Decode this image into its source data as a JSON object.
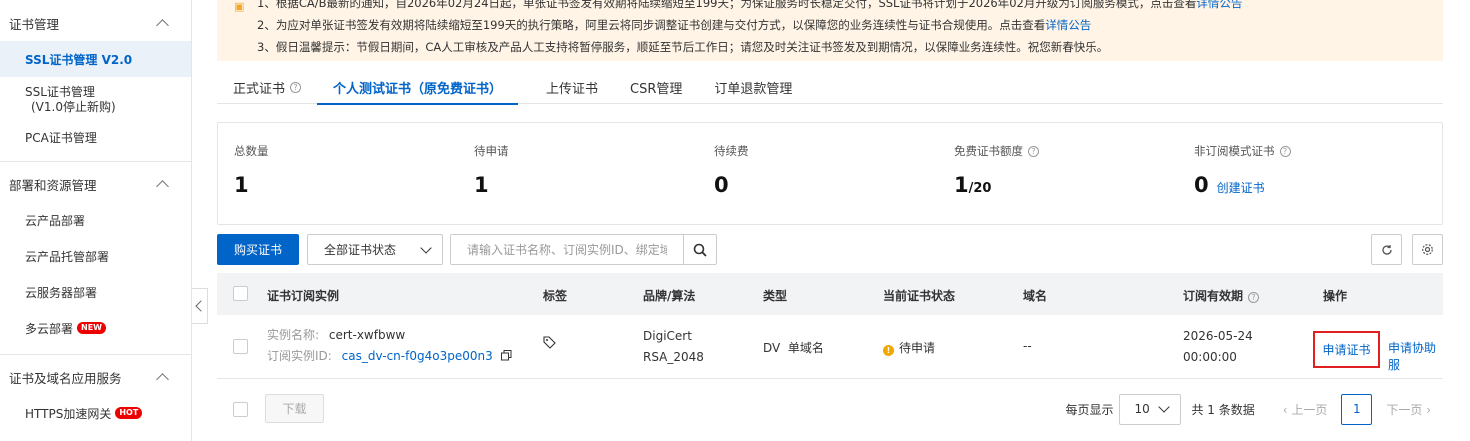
{
  "sidebar": {
    "groups": [
      {
        "label": "证书管理"
      },
      {
        "label": "部署和资源管理"
      },
      {
        "label": "证书及域名应用服务"
      }
    ],
    "items": [
      {
        "label": "SSL证书管理 V2.0"
      },
      {
        "label": "SSL证书管理"
      },
      {
        "label": "(V1.0停止新购)"
      },
      {
        "label": "PCA证书管理"
      },
      {
        "label": "云产品部署"
      },
      {
        "label": "云产品托管部署"
      },
      {
        "label": "云服务器部署"
      },
      {
        "label": "多云部署",
        "badge": "NEW"
      },
      {
        "label": "HTTPS加速网关",
        "badge": "HOT"
      }
    ]
  },
  "notice": {
    "line1": "1、根据CA/B最新的通知，自2026年02月24日起，单张证书签发有效期将陆续缩短至199天；为保证服务时长稳定交付，SSL证书将计划于2026年02月升级为订阅服务模式，点击查看",
    "line1_link": "详情公告",
    "line2": "2、为应对单张证书签发有效期将陆续缩短至199天的执行策略，阿里云将同步调整证书创建与交付方式，以保障您的业务连续性与证书合规使用。点击查看",
    "line2_link": "详情公告",
    "line3": "3、假日温馨提示：节假日期间，CA人工审核及产品人工支持将暂停服务，顺延至节后工作日；请您及时关注证书签发及到期情况，以保障业务连续性。祝您新春快乐。"
  },
  "tabs": [
    {
      "label": "正式证书"
    },
    {
      "label": "个人测试证书（原免费证书）",
      "active": true
    },
    {
      "label": "上传证书"
    },
    {
      "label": "CSR管理"
    },
    {
      "label": "订单退款管理"
    }
  ],
  "stats": [
    {
      "label": "总数量",
      "value": "1"
    },
    {
      "label": "待申请",
      "value": "1"
    },
    {
      "label": "待续费",
      "value": "0"
    },
    {
      "label": "免费证书额度",
      "value": "1",
      "suffix": "/20"
    },
    {
      "label": "非订阅模式证书",
      "value": "0",
      "link": "创建证书"
    }
  ],
  "toolbar": {
    "buy_label": "购买证书",
    "status_filter": "全部证书状态",
    "search_placeholder": "请输入证书名称、订阅实例ID、绑定域名"
  },
  "table": {
    "headers": [
      "证书订阅实例",
      "标签",
      "品牌/算法",
      "类型",
      "当前证书状态",
      "域名",
      "订阅有效期",
      "操作"
    ],
    "row": {
      "instance_name_label": "实例名称:",
      "instance_name": "cert-xwfbww",
      "instance_id_label": "订阅实例ID:",
      "instance_id": "cas_dv-cn-f0g4o3pe00n3",
      "brand": "DigiCert",
      "algorithm": "RSA_2048",
      "type": "DV  单域名",
      "status": "待申请",
      "domain": "--",
      "expire_date": "2026-05-24",
      "expire_time": "00:00:00",
      "action_apply": "申请证书",
      "action_assist": "申请协助服"
    }
  },
  "footer": {
    "download_label": "下载",
    "per_page_label": "每页显示",
    "per_page_value": "10",
    "total_label": "共 1 条数据",
    "prev_label": "上一页",
    "current_page": "1",
    "next_label": "下一页"
  },
  "colors": {
    "accent": "#0064c8",
    "warning": "#f0a800",
    "highlight_border": "#e02020"
  }
}
